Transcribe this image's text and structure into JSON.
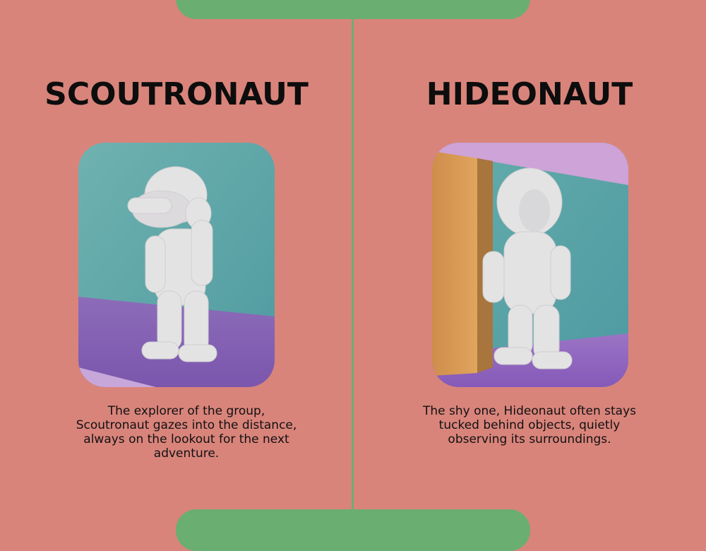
{
  "cards": [
    {
      "title": "SCOUTRONAUT",
      "description": "The explorer of the group, Scoutronaut gazes into the distance, always on the lookout for the next adventure."
    },
    {
      "title": "HIDEONAUT",
      "description": "The shy one, Hideonaut often stays tucked behind objects, quietly observing its surroundings."
    }
  ],
  "colors": {
    "background": "#d9847b",
    "accent_green": "#6aae71",
    "wall_teal": "#5da7a7",
    "floor_purple": "#8b62b5",
    "pink_wall": "#cba2d6",
    "crate_orange": "#d89a55",
    "figure_white": "#e6e5e6"
  }
}
